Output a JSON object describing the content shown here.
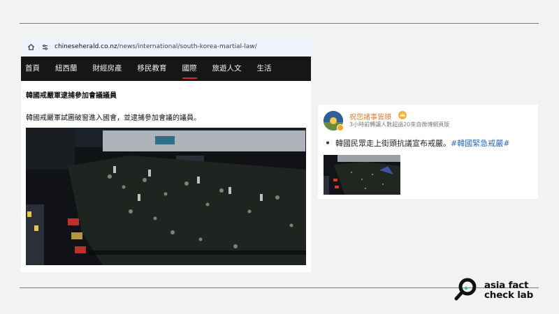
{
  "news": {
    "url_host": "chineseherald.co.nz",
    "url_path": "/news/international/south-korea-martial-law/",
    "nav": [
      "首頁",
      "紐西蘭",
      "財經房產",
      "移民教育",
      "國際",
      "旅遊人文",
      "生活"
    ],
    "nav_active_index": 4,
    "title": "韓國戒嚴軍逮捕參加會議議員",
    "lede": "韓國戒嚴軍試圖破窗進入國會，並逮捕參加會議的議員。"
  },
  "post": {
    "username": "祝您諸事皆順",
    "meta": "3小時前轉讓人數超過20來自微博網頁版",
    "text": "韓國民眾走上街頭抗議宣布戒嚴。",
    "hashtag": "#韓國緊急戒嚴#"
  },
  "logo": {
    "line1": "asia fact",
    "line2": "check lab"
  },
  "colors": {
    "accent_red": "#e0242e",
    "username_orange": "#e8782a",
    "hashtag_blue": "#2a6ab8",
    "nav_bg": "#161616"
  }
}
